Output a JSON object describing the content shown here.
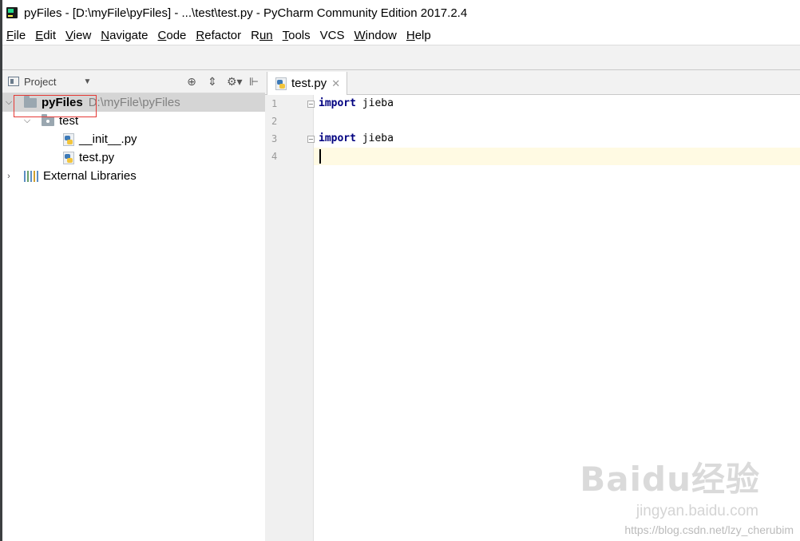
{
  "window": {
    "title": "pyFiles - [D:\\myFile\\pyFiles] - ...\\test\\test.py - PyCharm Community Edition 2017.2.4"
  },
  "menu": [
    {
      "mn": "F",
      "rest": "ile"
    },
    {
      "mn": "E",
      "rest": "dit"
    },
    {
      "mn": "V",
      "rest": "iew"
    },
    {
      "mn": "N",
      "rest": "avigate"
    },
    {
      "mn": "C",
      "rest": "ode"
    },
    {
      "mn": "R",
      "rest": "efactor"
    },
    {
      "mn": "R",
      "rest": "un"
    },
    {
      "mn": "T",
      "rest": "ools"
    },
    {
      "mn": "VCS",
      "rest": ""
    },
    {
      "mn": "W",
      "rest": "indow"
    },
    {
      "mn": "H",
      "rest": "elp"
    }
  ],
  "project_panel": {
    "title": "Project",
    "dropdown": "▼",
    "tools": [
      "⊕",
      "⇕",
      "⚙▾",
      "⊩"
    ]
  },
  "tree": {
    "root_name": "pyFiles",
    "root_path": "D:\\myFile\\pyFiles",
    "folder": "test",
    "files": [
      "__init__.py",
      "test.py"
    ],
    "external": "External Libraries"
  },
  "editor": {
    "tab_label": "test.py",
    "tab_close": "✕",
    "lines": [
      {
        "num": "1",
        "kw": "import",
        "rest": " jieba"
      },
      {
        "num": "2",
        "kw": "",
        "rest": ""
      },
      {
        "num": "3",
        "kw": "import",
        "rest": " jieba"
      },
      {
        "num": "4",
        "kw": "",
        "rest": ""
      }
    ]
  },
  "watermarks": {
    "baidu": "Baidu经验",
    "jingyan": "jingyan.baidu.com",
    "csdn": "https://blog.csdn.net/lzy_cherubim"
  },
  "colors": {
    "keyword": "#000080",
    "current_line": "#fffae3",
    "selection": "#d5d5d5",
    "highlight_box": "#e53935"
  }
}
